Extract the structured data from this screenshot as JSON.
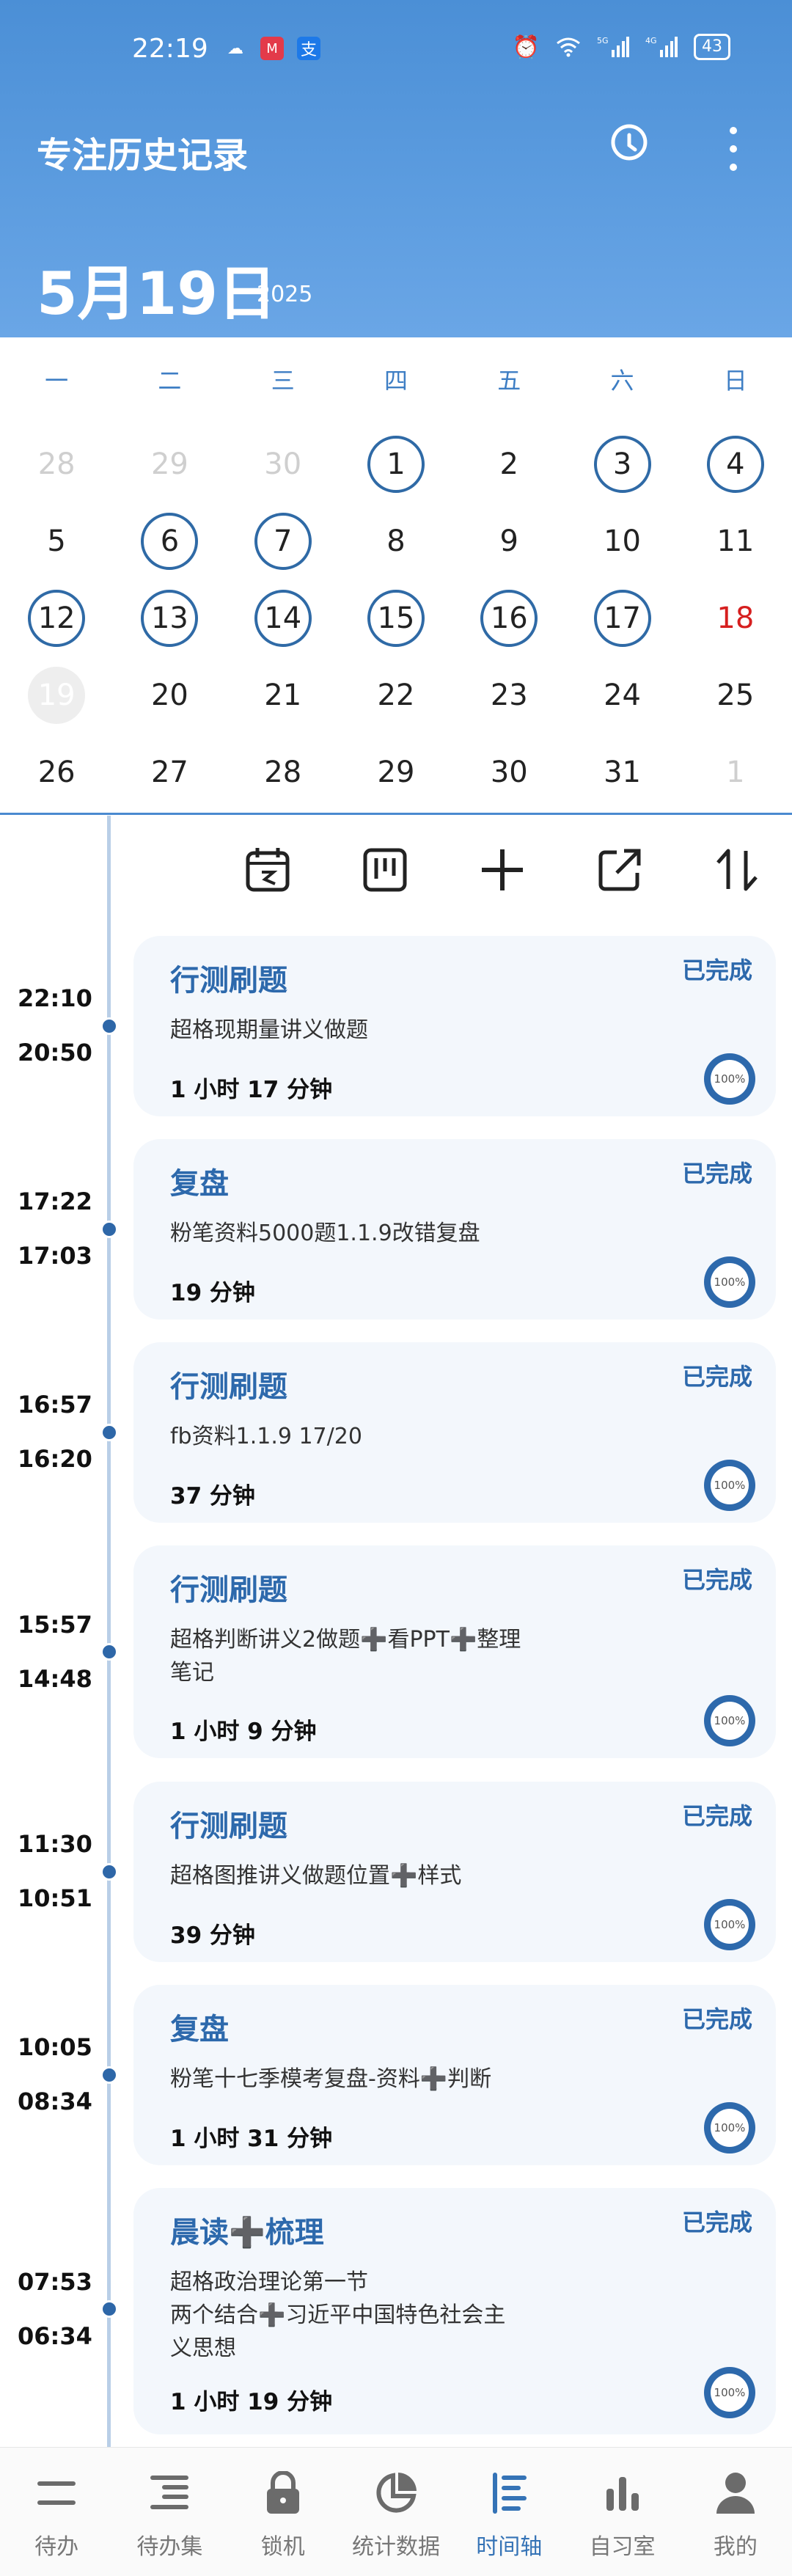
{
  "status_bar": {
    "time": "22:19",
    "battery": "43",
    "net1": "5G",
    "net2": "4G"
  },
  "header": {
    "title": "专注历史记录",
    "date": "5月19日",
    "year": "2025"
  },
  "calendar": {
    "weekdays": [
      "一",
      "二",
      "三",
      "四",
      "五",
      "六",
      "日"
    ],
    "days": [
      {
        "d": "28",
        "s": "faded"
      },
      {
        "d": "29",
        "s": "faded"
      },
      {
        "d": "30",
        "s": "faded"
      },
      {
        "d": "1",
        "s": "ring"
      },
      {
        "d": "2",
        "s": ""
      },
      {
        "d": "3",
        "s": "ring"
      },
      {
        "d": "4",
        "s": "ring"
      },
      {
        "d": "5",
        "s": ""
      },
      {
        "d": "6",
        "s": "ring"
      },
      {
        "d": "7",
        "s": "ring"
      },
      {
        "d": "8",
        "s": ""
      },
      {
        "d": "9",
        "s": ""
      },
      {
        "d": "10",
        "s": ""
      },
      {
        "d": "11",
        "s": ""
      },
      {
        "d": "12",
        "s": "ring"
      },
      {
        "d": "13",
        "s": "ring"
      },
      {
        "d": "14",
        "s": "ring"
      },
      {
        "d": "15",
        "s": "ring"
      },
      {
        "d": "16",
        "s": "ring"
      },
      {
        "d": "17",
        "s": "ring"
      },
      {
        "d": "18",
        "s": "sunday"
      },
      {
        "d": "19",
        "s": "today"
      },
      {
        "d": "20",
        "s": ""
      },
      {
        "d": "21",
        "s": ""
      },
      {
        "d": "22",
        "s": ""
      },
      {
        "d": "23",
        "s": ""
      },
      {
        "d": "24",
        "s": ""
      },
      {
        "d": "25",
        "s": ""
      },
      {
        "d": "26",
        "s": ""
      },
      {
        "d": "27",
        "s": ""
      },
      {
        "d": "28",
        "s": ""
      },
      {
        "d": "29",
        "s": ""
      },
      {
        "d": "30",
        "s": ""
      },
      {
        "d": "31",
        "s": ""
      },
      {
        "d": "1",
        "s": "faded"
      }
    ]
  },
  "toolbar": [
    "calendar-icon",
    "board-icon",
    "add-icon",
    "export-icon",
    "sort-icon"
  ],
  "entries": [
    {
      "end": "22:10",
      "start": "20:50",
      "title": "行测刷题",
      "status": "已完成",
      "desc": "超格现期量讲义做题",
      "duration": "1 小时 17 分钟",
      "progress": "100%"
    },
    {
      "end": "17:22",
      "start": "17:03",
      "title": "复盘",
      "status": "已完成",
      "desc": "粉笔资料5000题1.1.9改错复盘",
      "duration": "19 分钟",
      "progress": "100%"
    },
    {
      "end": "16:57",
      "start": "16:20",
      "title": "行测刷题",
      "status": "已完成",
      "desc": "fb资料1.1.9  17/20",
      "duration": "37 分钟",
      "progress": "100%"
    },
    {
      "end": "15:57",
      "start": "14:48",
      "title": "行测刷题",
      "status": "已完成",
      "desc": "超格判断讲义2做题➕看PPT➕整理\n笔记",
      "duration": "1 小时 9 分钟",
      "progress": "100%"
    },
    {
      "end": "11:30",
      "start": "10:51",
      "title": "行测刷题",
      "status": "已完成",
      "desc": "超格图推讲义做题位置➕样式",
      "duration": "39 分钟",
      "progress": "100%"
    },
    {
      "end": "10:05",
      "start": "08:34",
      "title": "复盘",
      "status": "已完成",
      "desc": "粉笔十七季模考复盘-资料➕判断",
      "duration": "1 小时 31 分钟",
      "progress": "100%"
    },
    {
      "end": "07:53",
      "start": "06:34",
      "title": "晨读➕梳理",
      "status": "已完成",
      "desc": "超格政治理论第一节\n两个结合➕习近平中国特色社会主\n义思想",
      "duration": "1 小时 19 分钟",
      "progress": "100%"
    }
  ],
  "nav": [
    {
      "label": "待办",
      "icon": "menu-icon",
      "active": false
    },
    {
      "label": "待办集",
      "icon": "list-icon",
      "active": false
    },
    {
      "label": "锁机",
      "icon": "lock-icon",
      "active": false
    },
    {
      "label": "统计数据",
      "icon": "pie-chart-icon",
      "active": false
    },
    {
      "label": "时间轴",
      "icon": "timeline-icon",
      "active": true
    },
    {
      "label": "自习室",
      "icon": "bar-chart-icon",
      "active": false
    },
    {
      "label": "我的",
      "icon": "user-icon",
      "active": false
    }
  ]
}
